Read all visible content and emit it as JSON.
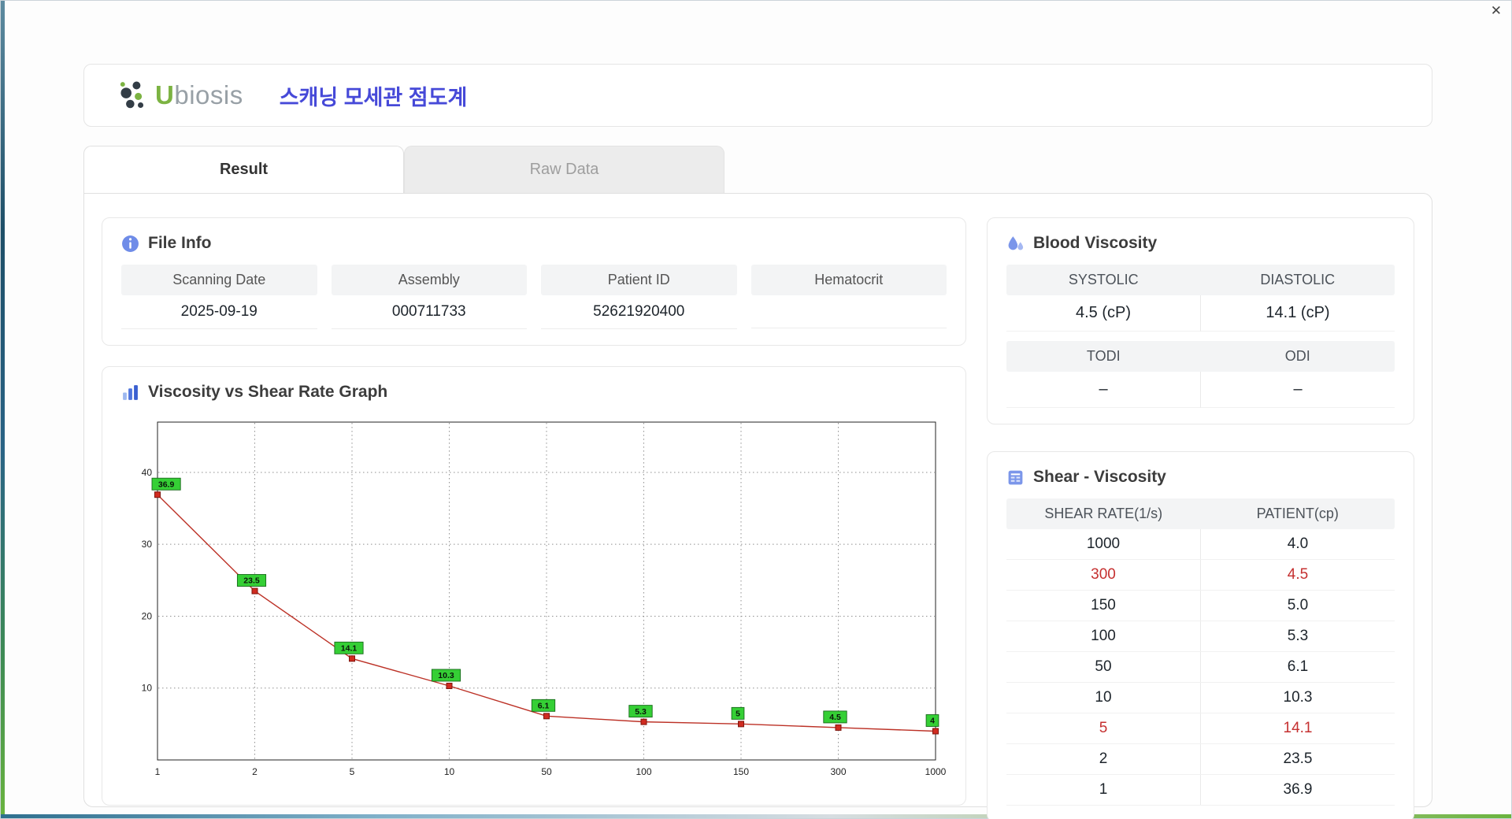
{
  "window": {
    "close_icon": "✕"
  },
  "header": {
    "brand_u": "U",
    "brand_rest": "biosis",
    "title": "스캐닝 모세관 점도계"
  },
  "tabs": {
    "result": "Result",
    "raw_data": "Raw Data"
  },
  "file_info": {
    "title": "File Info",
    "fields": [
      {
        "label": "Scanning Date",
        "value": "2025-09-19"
      },
      {
        "label": "Assembly",
        "value": "000711733"
      },
      {
        "label": "Patient ID",
        "value": "52621920400"
      },
      {
        "label": "Hematocrit",
        "value": ""
      }
    ]
  },
  "blood_viscosity": {
    "title": "Blood Viscosity",
    "rows": [
      {
        "headers": [
          "SYSTOLIC",
          "DIASTOLIC"
        ],
        "values": [
          "4.5 (cP)",
          "14.1 (cP)"
        ]
      },
      {
        "headers": [
          "TODI",
          "ODI"
        ],
        "values": [
          "–",
          "–"
        ]
      }
    ]
  },
  "shear_viscosity": {
    "title": "Shear - Viscosity",
    "columns": [
      "SHEAR RATE(1/s)",
      "PATIENT(cp)"
    ],
    "rows": [
      {
        "rate": "1000",
        "patient": "4.0",
        "highlight": false
      },
      {
        "rate": "300",
        "patient": "4.5",
        "highlight": true
      },
      {
        "rate": "150",
        "patient": "5.0",
        "highlight": false
      },
      {
        "rate": "100",
        "patient": "5.3",
        "highlight": false
      },
      {
        "rate": "50",
        "patient": "6.1",
        "highlight": false
      },
      {
        "rate": "10",
        "patient": "10.3",
        "highlight": false
      },
      {
        "rate": "5",
        "patient": "14.1",
        "highlight": true
      },
      {
        "rate": "2",
        "patient": "23.5",
        "highlight": false
      },
      {
        "rate": "1",
        "patient": "36.9",
        "highlight": false
      }
    ]
  },
  "graph": {
    "title": "Viscosity vs Shear Rate Graph"
  },
  "chart_data": {
    "type": "line",
    "title": "Viscosity vs Shear Rate Graph",
    "x": [
      1,
      2,
      5,
      10,
      50,
      100,
      150,
      300,
      1000
    ],
    "x_tick_labels": [
      "1",
      "2",
      "5",
      "10",
      "50",
      "100",
      "150",
      "300",
      "1000"
    ],
    "x_scale": "categorical-equal-spacing",
    "series": [
      {
        "name": "Patient viscosity (cP)",
        "values": [
          36.9,
          23.5,
          14.1,
          10.3,
          6.1,
          5.3,
          5,
          4.5,
          4
        ]
      }
    ],
    "point_labels": [
      "36.9",
      "23.5",
      "14.1",
      "10.3",
      "6.1",
      "5.3",
      "5",
      "4.5",
      "4"
    ],
    "xlabel": "",
    "ylabel": "",
    "ylim": [
      0,
      47
    ],
    "yticks": [
      10,
      20,
      30,
      40
    ],
    "grid": "dotted",
    "legend": "none",
    "line_color": "#bc3126",
    "marker_color": "#d02b20",
    "label_box_color": "#35cf35"
  },
  "colors": {
    "accent_blue": "#4649d8",
    "brand_green": "#7cb342",
    "highlight_red": "#c53030",
    "header_band": "#f3f4f5"
  }
}
